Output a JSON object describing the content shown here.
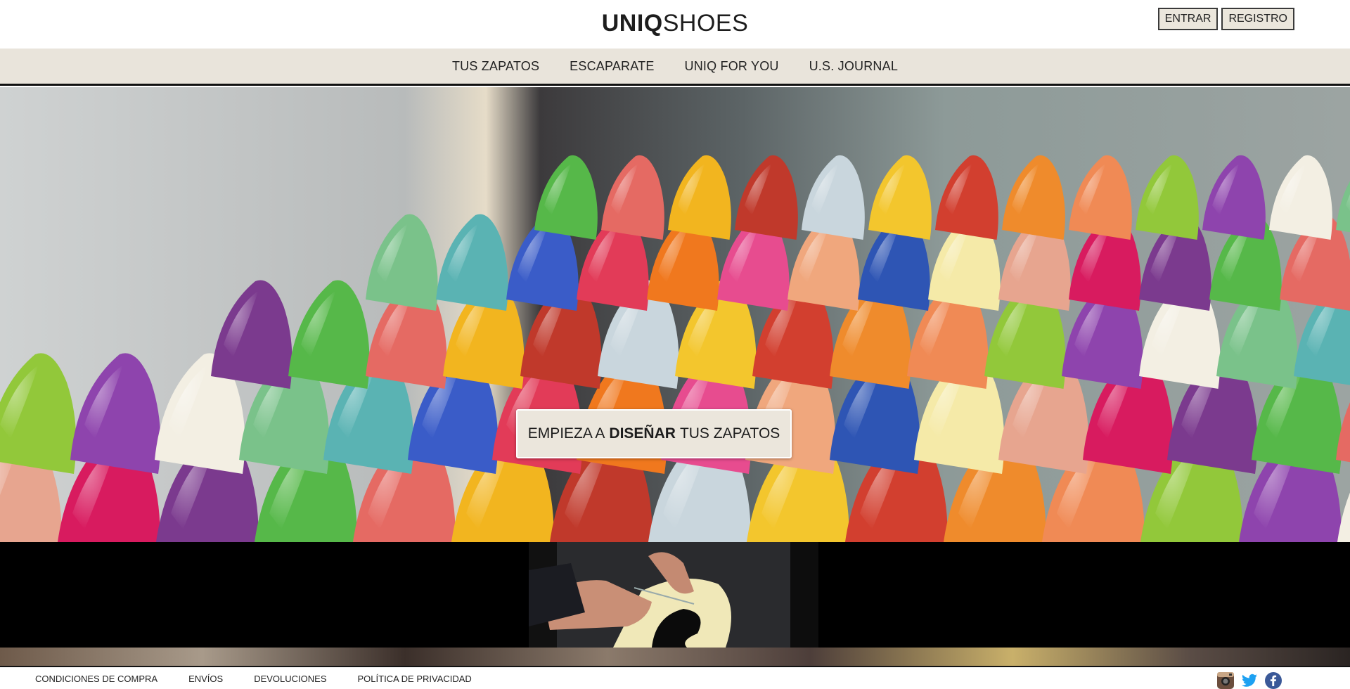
{
  "header": {
    "logo_bold": "UNIQ",
    "logo_light": "SHOES",
    "login_label": "ENTRAR",
    "register_label": "REGISTRO"
  },
  "nav": {
    "items": [
      {
        "label": "TUS ZAPATOS"
      },
      {
        "label": "ESCAPARATE"
      },
      {
        "label": "UNIQ FOR YOU"
      },
      {
        "label": "U.S. JOURNAL"
      }
    ]
  },
  "hero": {
    "cta_prefix": "EMPIEZA A",
    "cta_bold": "DISEÑAR",
    "cta_suffix": "TUS ZAPATOS"
  },
  "footer": {
    "links": [
      {
        "label": "CONDICIONES DE COMPRA"
      },
      {
        "label": "ENVÍOS"
      },
      {
        "label": "DEVOLUCIONES"
      },
      {
        "label": "POLÍTICA DE PRIVACIDAD"
      }
    ],
    "social": [
      "instagram-icon",
      "twitter-icon",
      "facebook-icon"
    ]
  },
  "colors": {
    "nav_bg": "#e9e4db",
    "button_bg": "#ebe6dc",
    "twitter": "#1da1f2",
    "facebook": "#3b5998"
  }
}
